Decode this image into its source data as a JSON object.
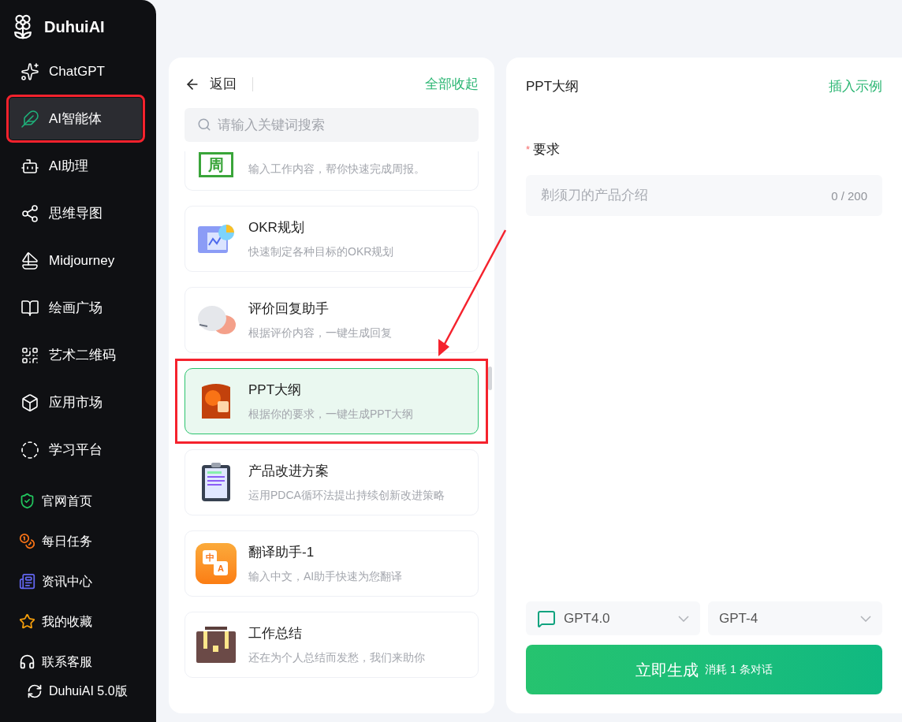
{
  "sidebar": {
    "brand": "DuhuiAI",
    "nav_items": [
      {
        "label": "ChatGPT",
        "selected": false,
        "highlighted": false
      },
      {
        "label": "AI智能体",
        "selected": true,
        "highlighted": true
      },
      {
        "label": "AI助理",
        "selected": false,
        "highlighted": false
      },
      {
        "label": "思维导图",
        "selected": false,
        "highlighted": false
      },
      {
        "label": "Midjourney",
        "selected": false,
        "highlighted": false
      },
      {
        "label": "绘画广场",
        "selected": false,
        "highlighted": false
      },
      {
        "label": "艺术二维码",
        "selected": false,
        "highlighted": false
      },
      {
        "label": "应用市场",
        "selected": false,
        "highlighted": false
      },
      {
        "label": "学习平台",
        "selected": false,
        "highlighted": false
      }
    ],
    "links": [
      {
        "label": "官网首页"
      },
      {
        "label": "每日任务"
      },
      {
        "label": "资讯中心"
      },
      {
        "label": "我的收藏"
      },
      {
        "label": "联系客服"
      }
    ],
    "version": "DuhuiAI 5.0版"
  },
  "agent_list": {
    "back": "返回",
    "collapse_all": "全部收起",
    "search": {
      "placeholder": "请输入关键词搜索"
    },
    "cards": [
      {
        "kind": "clipped",
        "icon_text": "周",
        "description": "输入工作内容，帮你快速完成周报。",
        "selected": false,
        "highlighted": false
      },
      {
        "kind": "full",
        "title": "OKR规划",
        "description": "快速制定各种目标的OKR规划",
        "selected": false,
        "highlighted": false
      },
      {
        "kind": "full",
        "title": "评价回复助手",
        "description": "根据评价内容，一键生成回复",
        "selected": false,
        "highlighted": false
      },
      {
        "kind": "full",
        "title": "PPT大纲",
        "description": "根据你的要求，一键生成PPT大纲",
        "selected": true,
        "highlighted": true
      },
      {
        "kind": "full",
        "title": "产品改进方案",
        "description": "运用PDCA循环法提出持续创新改进策略",
        "selected": false,
        "highlighted": false
      },
      {
        "kind": "full",
        "title": "翻译助手-1",
        "icon_text": [
          "中",
          "A"
        ],
        "description": "输入中文，AI助手快速为您翻译",
        "selected": false,
        "highlighted": false
      },
      {
        "kind": "full",
        "title": "工作总结",
        "description": "还在为个人总结而发愁，我们来助你",
        "selected": false,
        "highlighted": false
      }
    ]
  },
  "form": {
    "title": "PPT大纲",
    "insert_example": "插入示例",
    "field": {
      "label": "要求",
      "required_mark": "*",
      "placeholder": "剃须刀的产品介绍",
      "counter": "0 / 200"
    },
    "model_select": {
      "value": "GPT4.0"
    },
    "version_select": {
      "value": "GPT-4"
    },
    "submit": {
      "label": "立即生成",
      "note": "消耗 1 条对话"
    }
  }
}
